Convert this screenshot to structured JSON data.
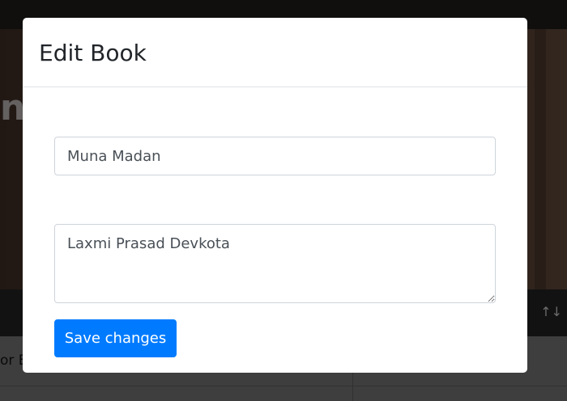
{
  "background": {
    "hero_text": "nt",
    "table_cell_text": "or B",
    "sort_icon": "↑↓"
  },
  "modal": {
    "title": "Edit Book",
    "book_title_value": "Muna Madan",
    "book_author_value": "Laxmi Prasad Devkota",
    "save_label": "Save changes"
  },
  "colors": {
    "primary": "#007bff",
    "border": "#ced4da",
    "text": "#495057"
  }
}
